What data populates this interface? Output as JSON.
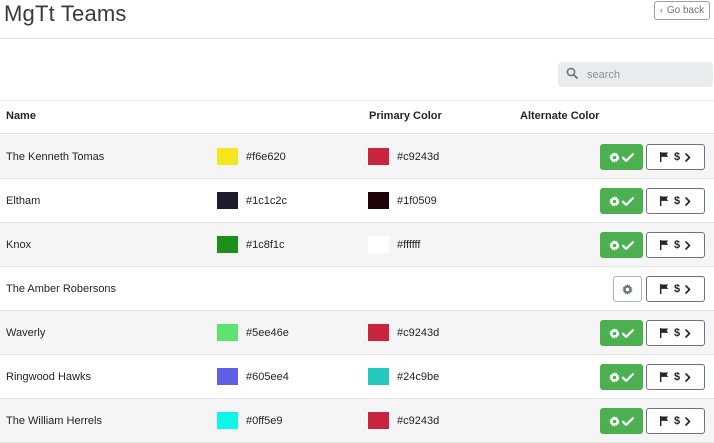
{
  "page": {
    "title": "MgTt Teams",
    "back_label": "Go back"
  },
  "search": {
    "placeholder": "search"
  },
  "table": {
    "headers": {
      "name": "Name",
      "primary": "Primary Color",
      "alternate": "Alternate Color"
    },
    "rows": [
      {
        "name": "The Kenneth Tomas",
        "primary": "#f6e620",
        "alternate": "#c9243d",
        "configured": true
      },
      {
        "name": "Eltham",
        "primary": "#1c1c2c",
        "alternate": "#1f0509",
        "configured": true
      },
      {
        "name": "Knox",
        "primary": "#1c8f1c",
        "alternate": "#ffffff",
        "configured": true
      },
      {
        "name": "The Amber Robersons",
        "primary": "",
        "alternate": "",
        "configured": false
      },
      {
        "name": "Waverly",
        "primary": "#5ee46e",
        "alternate": "#c9243d",
        "configured": true
      },
      {
        "name": "Ringwood Hawks",
        "primary": "#605ee4",
        "alternate": "#24c9be",
        "configured": true
      },
      {
        "name": "The William Herrels",
        "primary": "#0ff5e9",
        "alternate": "#c9243d",
        "configured": true
      }
    ],
    "action_symbol": "$"
  },
  "icons": {
    "back": "chevron-left-icon",
    "search": "search-icon",
    "settings": "gear-icon",
    "check": "check-icon",
    "flag": "flag-icon",
    "next": "chevron-right-icon"
  },
  "colors": {
    "configured_button": "#4caf50",
    "header_rule": "#dee2e6"
  }
}
